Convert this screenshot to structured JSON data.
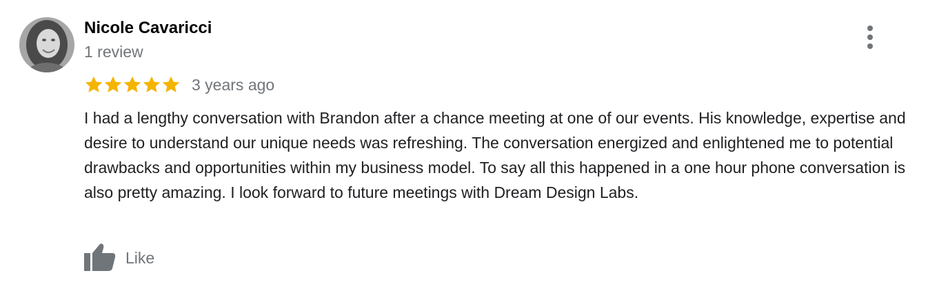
{
  "reviewer": {
    "name": "Nicole Cavaricci",
    "review_count": "1 review",
    "avatar_icon": "profile-photo"
  },
  "rating": {
    "stars": 5,
    "max_stars": 5,
    "star_color": "#f4b400",
    "time": "3 years ago"
  },
  "review": {
    "text": "I had a lengthy conversation with Brandon after a chance meeting at one of our events. His knowledge, expertise and desire to understand our unique needs was refreshing. The conversation energized and enlightened me to potential drawbacks and opportunities within my business model. To say all this happened in a one hour phone conversation is also pretty amazing. I look forward to future meetings with Dream Design Labs."
  },
  "actions": {
    "like_label": "Like",
    "like_icon": "thumbs-up-icon",
    "menu_icon": "more-vertical-icon"
  },
  "colors": {
    "name_text": "#000000",
    "secondary_text": "#70757a",
    "body_text": "#202124",
    "icon_gray": "#70757a"
  }
}
